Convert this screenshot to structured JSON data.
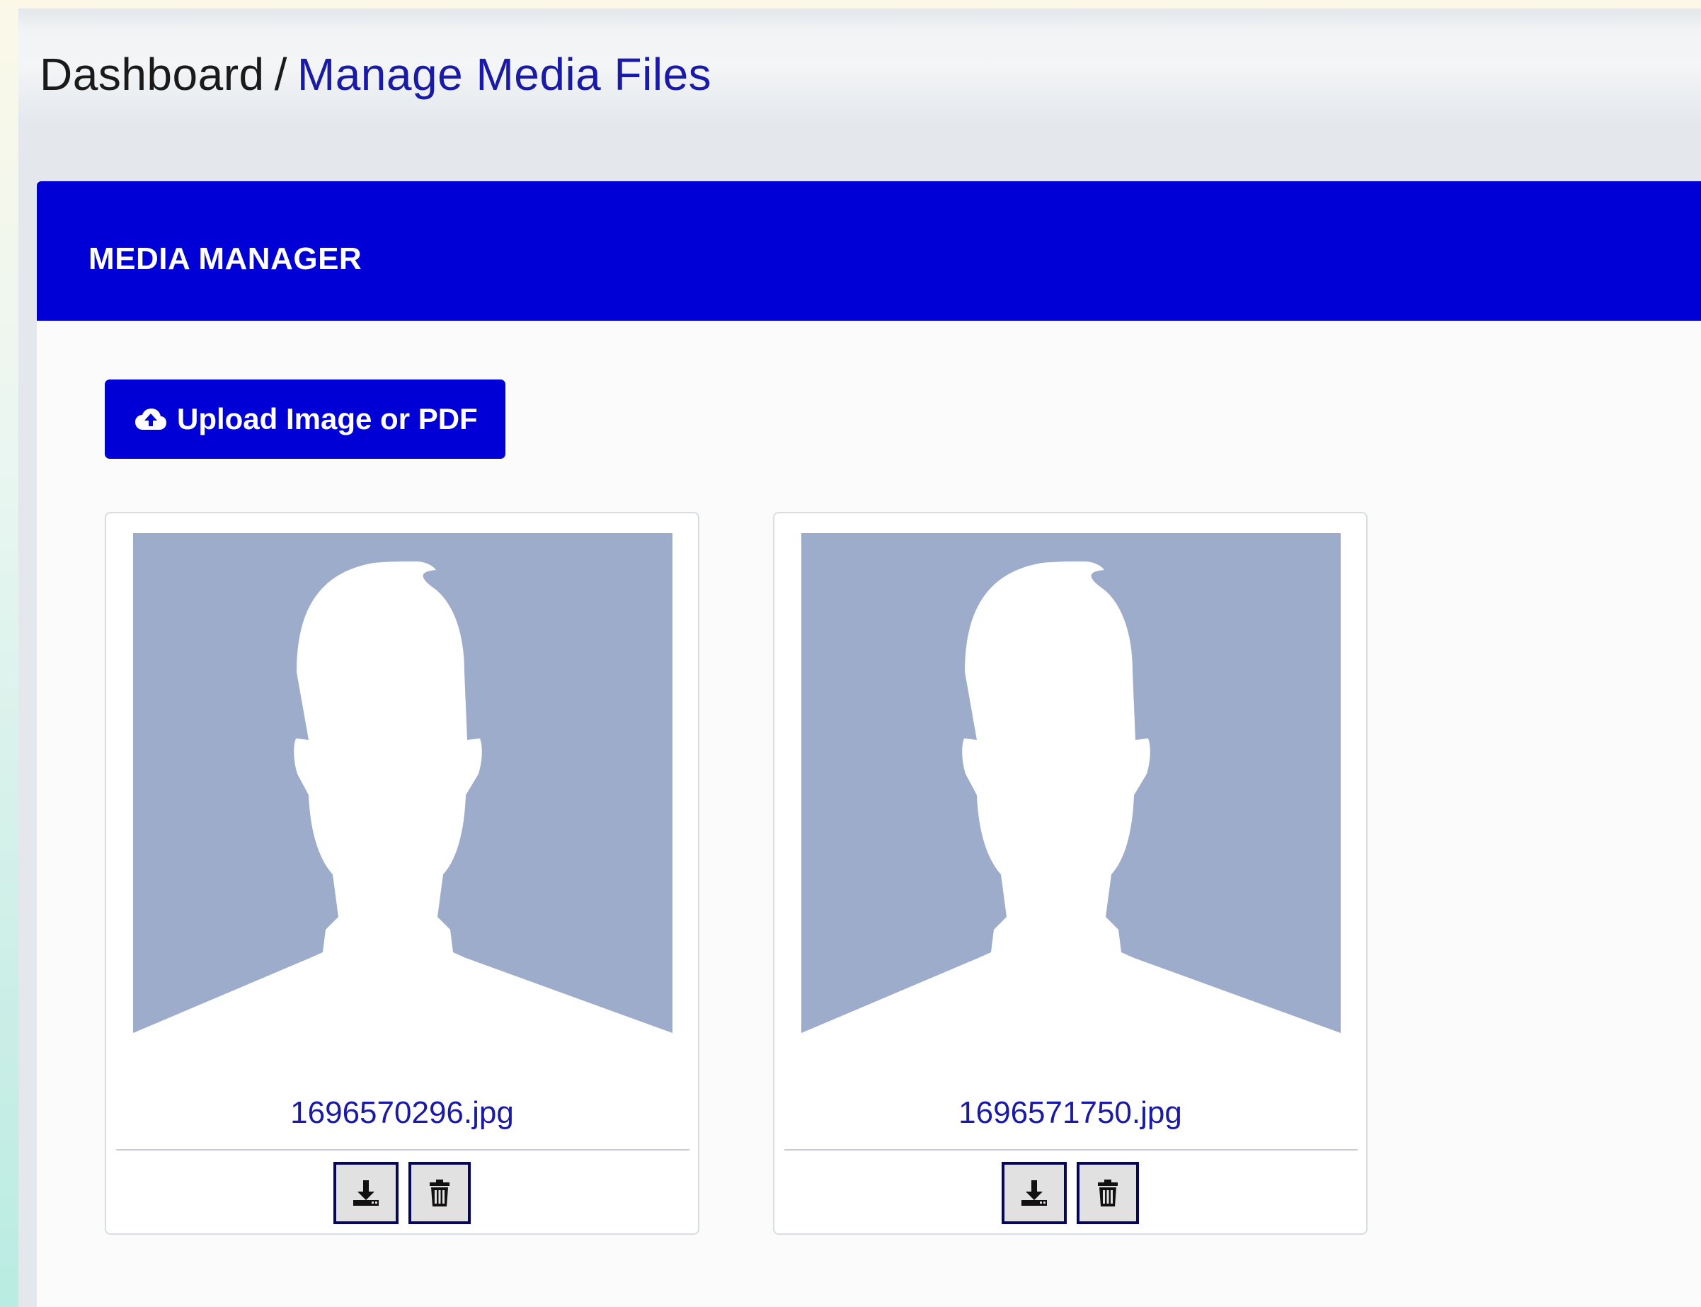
{
  "breadcrumb": {
    "root": "Dashboard",
    "separator": "/",
    "current": "Manage Media Files"
  },
  "card": {
    "title": "MEDIA MANAGER"
  },
  "upload": {
    "icon": "cloud-upload-icon",
    "label": "Upload Image or PDF"
  },
  "media": [
    {
      "filename": "1696570296.jpg",
      "thumbnail": "default-avatar-silhouette",
      "actions": [
        "download-icon",
        "trash-icon"
      ]
    },
    {
      "filename": "1696571750.jpg",
      "thumbnail": "default-avatar-silhouette",
      "actions": [
        "download-icon",
        "trash-icon"
      ]
    }
  ],
  "colors": {
    "accent": "#0000d6",
    "link": "#1a1aa8",
    "thumbnail_bg": "#9eaccb",
    "button_border": "#06065f"
  }
}
